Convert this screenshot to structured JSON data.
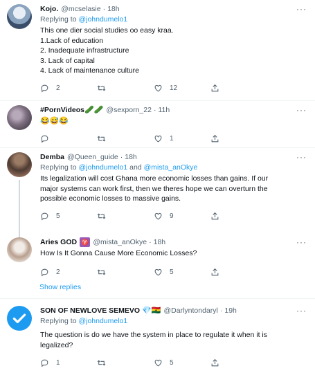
{
  "tweets": [
    {
      "name": "Kojo.",
      "handle": "@mcselasie",
      "time": "18h",
      "replying_label": "Replying to",
      "replying_to": "@johndumelo1",
      "replying_and": "",
      "replying_to2": "",
      "lines": [
        "This one dier social studies oo easy kraa.",
        "1.Lack of education",
        "2. Inadequate infrastructure",
        "3. Lack of capital",
        "4. Lack of maintenance culture"
      ],
      "replies": "2",
      "retweets": "",
      "likes": "12"
    },
    {
      "name": "#PornVideos",
      "name_emoji": "🥒🥒",
      "handle": "@sexporn_22",
      "time": "11h",
      "lines": [
        "😂😅😂"
      ],
      "replies": "",
      "retweets": "",
      "likes": "1"
    },
    {
      "name": "Demba",
      "handle": "@Queen_guide",
      "time": "18h",
      "replying_label": "Replying to",
      "replying_to": "@johndumelo1",
      "replying_and": "and",
      "replying_to2": "@mista_anOkye",
      "lines": [
        "Its legalization will cost Ghana more economic losses than gains. If our",
        "major systems can work first, then we theres hope we can overturn the",
        "possible economic losses to massive gains."
      ],
      "replies": "5",
      "retweets": "",
      "likes": "9"
    },
    {
      "name": "Aries GOD",
      "name_badge": "♈",
      "handle": "@mista_anOkye",
      "time": "18h",
      "lines": [
        "How Is It Gonna Cause More Economic Losses?"
      ],
      "replies": "2",
      "retweets": "",
      "likes": "5"
    },
    {
      "name": "SON OF NEWLOVE SEMEVO",
      "name_emoji": "💎🇬🇭",
      "handle": "@Darlyntondaryl",
      "time": "19h",
      "replying_label": "Replying to",
      "replying_to": "@johndumelo1",
      "replying_and": "",
      "replying_to2": "",
      "lines": [
        "The question is do we have the system in place to regulate it when it is",
        "legalized?"
      ],
      "replies": "1",
      "retweets": "",
      "likes": "5"
    }
  ],
  "show_replies": "Show replies",
  "dot": "·",
  "more": "···",
  "colors": {
    "accent": "#1d9bf0",
    "muted": "#536471"
  }
}
